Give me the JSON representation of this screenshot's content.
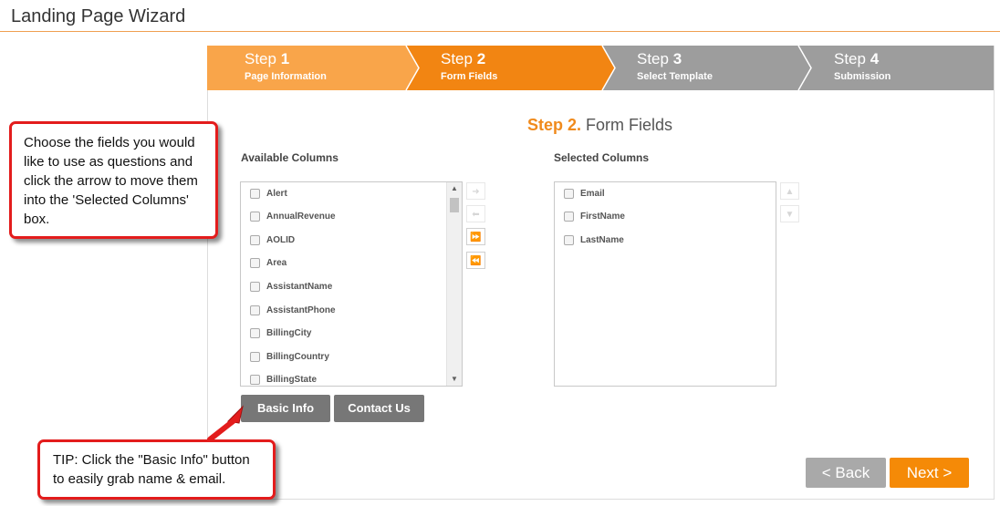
{
  "app": {
    "title": "Landing Page Wizard"
  },
  "steps": [
    {
      "word": "Step",
      "num": "1",
      "sub": "Page Information",
      "color": "#f9a54a"
    },
    {
      "word": "Step",
      "num": "2",
      "sub": "Form Fields",
      "color": "#f28512"
    },
    {
      "word": "Step",
      "num": "3",
      "sub": "Select Template",
      "color": "#9d9d9d"
    },
    {
      "word": "Step",
      "num": "4",
      "sub": "Submission",
      "color": "#9d9d9d"
    }
  ],
  "section": {
    "accent": "Step 2.",
    "title": "Form Fields"
  },
  "available": {
    "heading": "Available Columns",
    "items": [
      "Alert",
      "AnnualRevenue",
      "AOLID",
      "Area",
      "AssistantName",
      "AssistantPhone",
      "BillingCity",
      "BillingCountry",
      "BillingState"
    ]
  },
  "selected": {
    "heading": "Selected Columns",
    "items": [
      "Email",
      "FirstName",
      "LastName"
    ]
  },
  "move_buttons": {
    "move_right": "➜",
    "move_left": "⬅",
    "move_all_right": "⏩",
    "move_all_left": "⏪",
    "move_up": "▲",
    "move_down": "▼"
  },
  "preset_buttons": {
    "basic": "Basic Info",
    "contact": "Contact Us"
  },
  "nav": {
    "back": "< Back",
    "next": "Next >"
  },
  "callouts": {
    "columns_hint": "Choose the fields you would like to use as questions and click the arrow to move them into the 'Selected Columns' box.",
    "tip": "TIP: Click the \"Basic Info\" button to easily grab name & email."
  },
  "colors": {
    "accent": "#f08a1c",
    "callout_border": "#e31c1c"
  }
}
